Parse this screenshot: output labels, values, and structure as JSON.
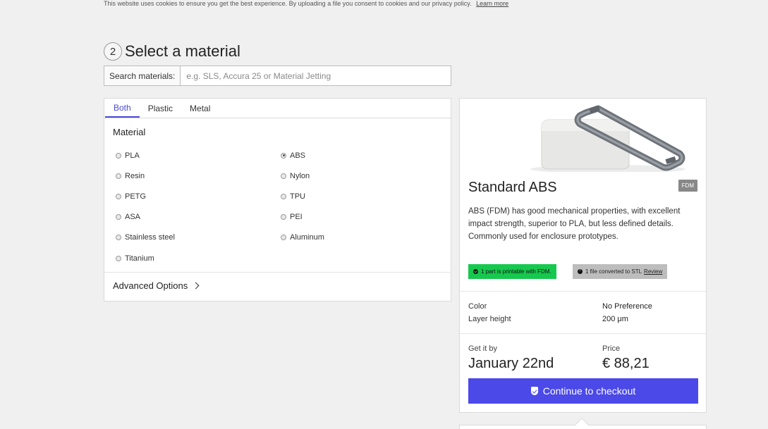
{
  "cookie": {
    "text": "This website uses cookies to ensure you get the best experience. By uploading a file you consent to cookies and our privacy policy.",
    "link": "Learn more"
  },
  "step": {
    "number": "2",
    "title": "Select a material"
  },
  "search": {
    "label": "Search materials:",
    "placeholder": "e.g. SLS, Accura 25 or Material Jetting",
    "value": ""
  },
  "tabs": [
    {
      "label": "Both",
      "active": true
    },
    {
      "label": "Plastic",
      "active": false
    },
    {
      "label": "Metal",
      "active": false
    }
  ],
  "material": {
    "heading": "Material",
    "options": [
      {
        "label": "PLA",
        "checked": false
      },
      {
        "label": "ABS",
        "checked": true
      },
      {
        "label": "Resin",
        "checked": false
      },
      {
        "label": "Nylon",
        "checked": false
      },
      {
        "label": "PETG",
        "checked": false
      },
      {
        "label": "TPU",
        "checked": false
      },
      {
        "label": "ASA",
        "checked": false
      },
      {
        "label": "PEI",
        "checked": false
      },
      {
        "label": "Stainless steel",
        "checked": false
      },
      {
        "label": "Aluminum",
        "checked": false
      },
      {
        "label": "Titanium",
        "checked": false
      }
    ],
    "advanced": "Advanced Options"
  },
  "card": {
    "title": "Standard ABS",
    "badge": "FDM",
    "description": "ABS (FDM) has good mechanical properties, with excellent impact strength, superior to PLA, but less defined details. Commonly used for enclosure prototypes.",
    "printable": "1 part is printable with FDM.",
    "converted": "1 file converted to STL",
    "review": "Review",
    "color_label": "Color",
    "color_value": "No Preference",
    "layer_label": "Layer height",
    "layer_value": "200 μm",
    "delivery_label": "Get it by",
    "delivery_value": "January 22nd",
    "price_label": "Price",
    "price_value": "€ 88,21",
    "checkout": "Continue to checkout"
  },
  "colors": {
    "accent": "#4b49e8",
    "success": "#17c84e",
    "background": "#f0f0f0"
  }
}
